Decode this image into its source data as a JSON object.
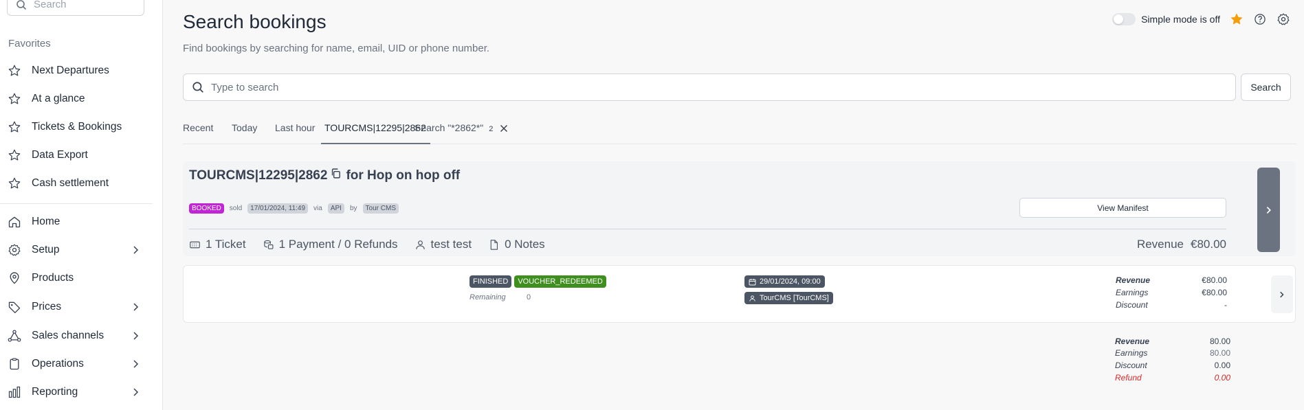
{
  "sidebar": {
    "search_placeholder": "Search",
    "favorites_label": "Favorites",
    "favorites": [
      {
        "label": "Next Departures"
      },
      {
        "label": "At a glance"
      },
      {
        "label": "Tickets & Bookings"
      },
      {
        "label": "Data Export"
      },
      {
        "label": "Cash settlement"
      }
    ],
    "nav": [
      {
        "label": "Home",
        "icon": "home-icon"
      },
      {
        "label": "Setup",
        "icon": "gear-icon"
      },
      {
        "label": "Products",
        "icon": "map-pin-icon"
      },
      {
        "label": "Prices",
        "icon": "tag-icon"
      },
      {
        "label": "Sales channels",
        "icon": "share-nodes-icon"
      },
      {
        "label": "Operations",
        "icon": "clipboard-icon"
      },
      {
        "label": "Reporting",
        "icon": "bar-chart-icon"
      }
    ]
  },
  "header": {
    "title": "Search bookings",
    "subtitle": "Find bookings by searching for name, email, UID or phone number.",
    "simple_mode_label": "Simple mode is off",
    "simple_mode_on": false
  },
  "search": {
    "placeholder": "Type to search",
    "value": "",
    "button_label": "Search"
  },
  "tabs": [
    {
      "label": "Recent"
    },
    {
      "label": "Today"
    },
    {
      "label": "Last hour"
    },
    {
      "label": "TOURCMS|12295|2862",
      "active": true
    },
    {
      "label": "Search \"*2862*\"",
      "badge": "2",
      "closable": true
    }
  ],
  "booking": {
    "id": "TOURCMS|12295|2862",
    "for_text": "for Hop on hop off",
    "status": "BOOKED",
    "sold_label": "sold",
    "sold_date": "17/01/2024, 11:49",
    "via_label": "via",
    "via_value": "API",
    "by_label": "by",
    "by_value": "Tour CMS",
    "view_manifest_label": "View Manifest",
    "stats": {
      "tickets": "1 Ticket",
      "payments": "1 Payment / 0 Refunds",
      "customer": "test test",
      "notes": "0 Notes"
    },
    "revenue_label": "Revenue",
    "revenue_value": "€80.00"
  },
  "ticket": {
    "status_1": "FINISHED",
    "status_2": "VOUCHER_REDEEMED",
    "remaining_label": "Remaining",
    "remaining_value": "0",
    "date": "29/01/2024, 09:00",
    "resource": "TourCMS [TourCMS]",
    "revenue_label": "Revenue",
    "revenue_value": "€80.00",
    "earnings_label": "Earnings",
    "earnings_value": "€80.00",
    "discount_label": "Discount",
    "discount_value": "-"
  },
  "totals": {
    "revenue_label": "Revenue",
    "revenue_value": "80.00",
    "earnings_label": "Earnings",
    "earnings_value": "80.00",
    "discount_label": "Discount",
    "discount_value": "0.00",
    "refund_label": "Refund",
    "refund_value": "0.00"
  },
  "colors": {
    "booked": "#c026d3",
    "redeemed": "#3f8f1f",
    "refund": "#dc2626",
    "star": "#f59e0b"
  }
}
